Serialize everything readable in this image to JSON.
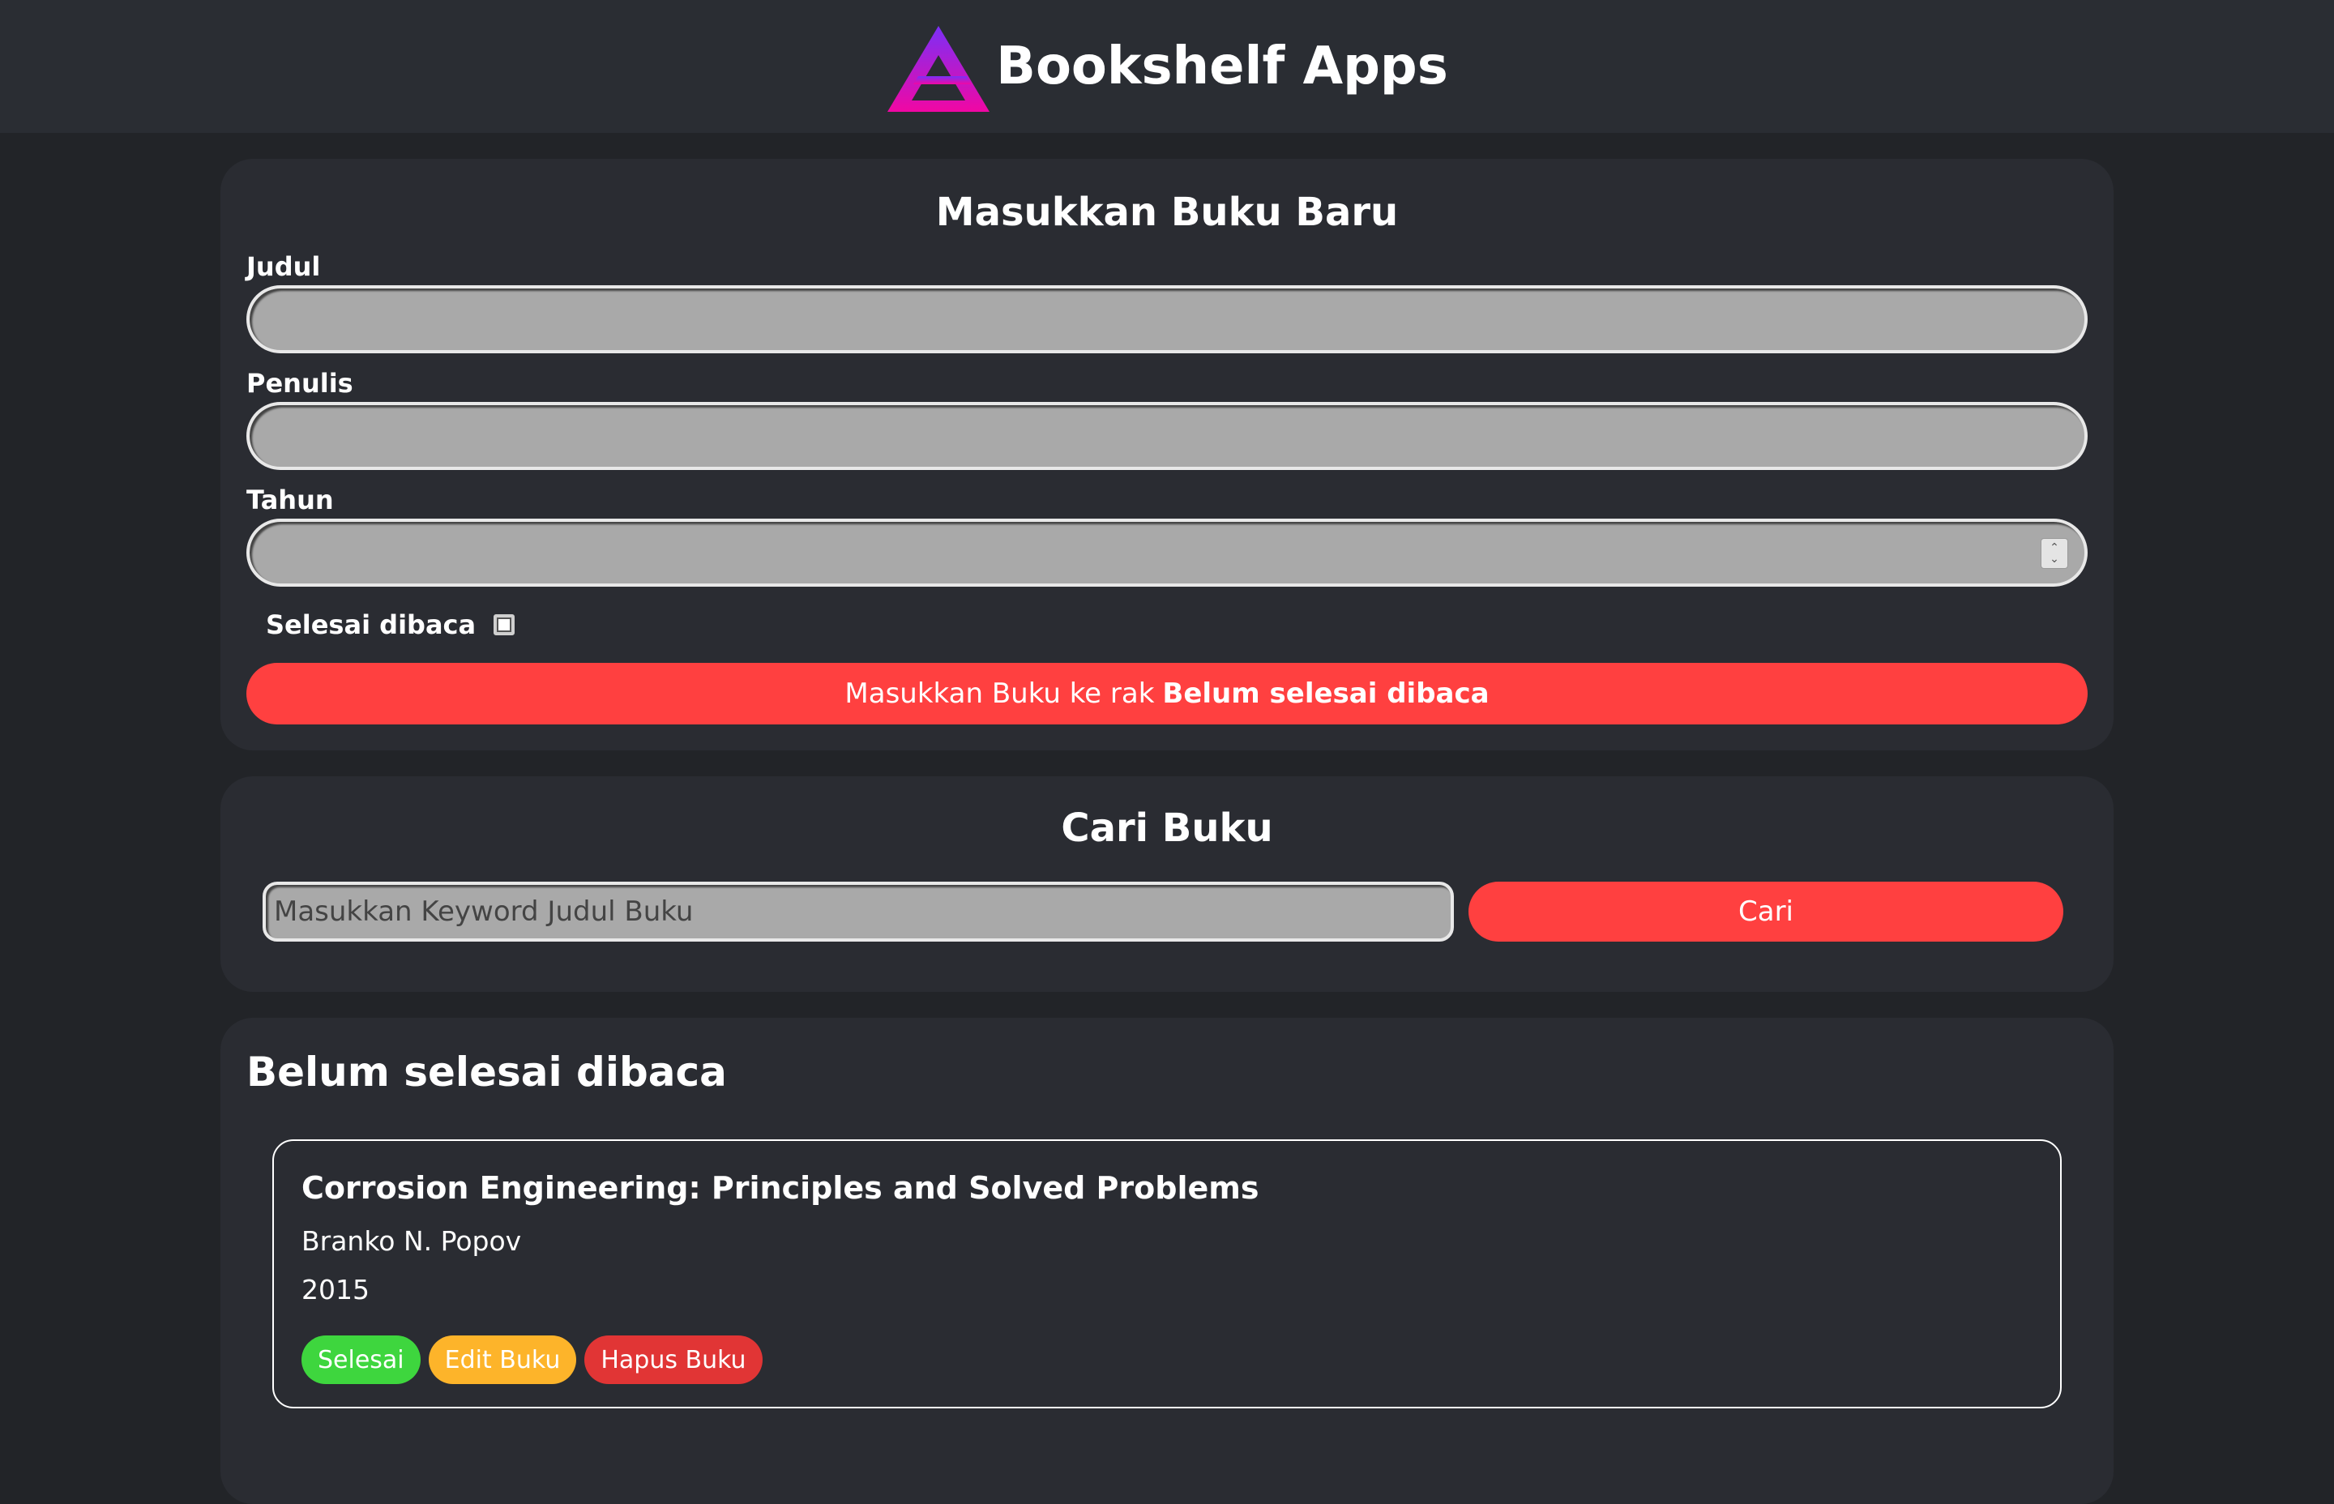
{
  "header": {
    "title": "Bookshelf Apps",
    "logo_icon": "triangle-logo-icon",
    "colors": {
      "logo_top": "#7b2ff7",
      "logo_bottom": "#f107a3"
    }
  },
  "form": {
    "title": "Masukkan Buku Baru",
    "fields": {
      "title_label": "Judul",
      "title_value": "",
      "author_label": "Penulis",
      "author_value": "",
      "year_label": "Tahun",
      "year_value": ""
    },
    "complete_label": "Selesai dibaca",
    "complete_checked": false,
    "submit_prefix": "Masukkan Buku ke rak",
    "submit_shelf": "Belum selesai dibaca"
  },
  "search": {
    "title": "Cari Buku",
    "placeholder": "Masukkan Keyword Judul Buku",
    "value": "",
    "button_label": "Cari"
  },
  "shelf_incomplete": {
    "title": "Belum selesai dibaca",
    "books": [
      {
        "title": "Corrosion Engineering: Principles and Solved Problems",
        "author": "Branko N. Popov",
        "year": "2015",
        "actions": [
          "Selesai",
          "Edit Buku",
          "Hapus Buku"
        ]
      }
    ]
  },
  "colors": {
    "background": "#222428",
    "card": "#2a2c32",
    "accent_red": "#ff4040",
    "green": "#3ed63e",
    "yellow": "#fdb42a",
    "delete_red": "#e13535"
  }
}
